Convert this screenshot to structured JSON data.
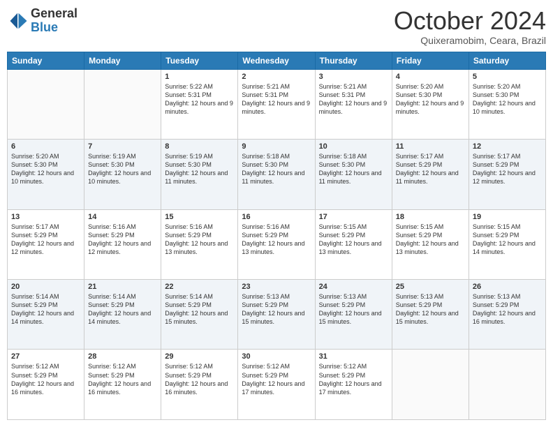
{
  "logo": {
    "general": "General",
    "blue": "Blue"
  },
  "header": {
    "month": "October 2024",
    "location": "Quixeramobim, Ceara, Brazil"
  },
  "weekdays": [
    "Sunday",
    "Monday",
    "Tuesday",
    "Wednesday",
    "Thursday",
    "Friday",
    "Saturday"
  ],
  "weeks": [
    [
      {
        "day": "",
        "info": ""
      },
      {
        "day": "",
        "info": ""
      },
      {
        "day": "1",
        "info": "Sunrise: 5:22 AM\nSunset: 5:31 PM\nDaylight: 12 hours and 9 minutes."
      },
      {
        "day": "2",
        "info": "Sunrise: 5:21 AM\nSunset: 5:31 PM\nDaylight: 12 hours and 9 minutes."
      },
      {
        "day": "3",
        "info": "Sunrise: 5:21 AM\nSunset: 5:31 PM\nDaylight: 12 hours and 9 minutes."
      },
      {
        "day": "4",
        "info": "Sunrise: 5:20 AM\nSunset: 5:30 PM\nDaylight: 12 hours and 9 minutes."
      },
      {
        "day": "5",
        "info": "Sunrise: 5:20 AM\nSunset: 5:30 PM\nDaylight: 12 hours and 10 minutes."
      }
    ],
    [
      {
        "day": "6",
        "info": "Sunrise: 5:20 AM\nSunset: 5:30 PM\nDaylight: 12 hours and 10 minutes."
      },
      {
        "day": "7",
        "info": "Sunrise: 5:19 AM\nSunset: 5:30 PM\nDaylight: 12 hours and 10 minutes."
      },
      {
        "day": "8",
        "info": "Sunrise: 5:19 AM\nSunset: 5:30 PM\nDaylight: 12 hours and 11 minutes."
      },
      {
        "day": "9",
        "info": "Sunrise: 5:18 AM\nSunset: 5:30 PM\nDaylight: 12 hours and 11 minutes."
      },
      {
        "day": "10",
        "info": "Sunrise: 5:18 AM\nSunset: 5:30 PM\nDaylight: 12 hours and 11 minutes."
      },
      {
        "day": "11",
        "info": "Sunrise: 5:17 AM\nSunset: 5:29 PM\nDaylight: 12 hours and 11 minutes."
      },
      {
        "day": "12",
        "info": "Sunrise: 5:17 AM\nSunset: 5:29 PM\nDaylight: 12 hours and 12 minutes."
      }
    ],
    [
      {
        "day": "13",
        "info": "Sunrise: 5:17 AM\nSunset: 5:29 PM\nDaylight: 12 hours and 12 minutes."
      },
      {
        "day": "14",
        "info": "Sunrise: 5:16 AM\nSunset: 5:29 PM\nDaylight: 12 hours and 12 minutes."
      },
      {
        "day": "15",
        "info": "Sunrise: 5:16 AM\nSunset: 5:29 PM\nDaylight: 12 hours and 13 minutes."
      },
      {
        "day": "16",
        "info": "Sunrise: 5:16 AM\nSunset: 5:29 PM\nDaylight: 12 hours and 13 minutes."
      },
      {
        "day": "17",
        "info": "Sunrise: 5:15 AM\nSunset: 5:29 PM\nDaylight: 12 hours and 13 minutes."
      },
      {
        "day": "18",
        "info": "Sunrise: 5:15 AM\nSunset: 5:29 PM\nDaylight: 12 hours and 13 minutes."
      },
      {
        "day": "19",
        "info": "Sunrise: 5:15 AM\nSunset: 5:29 PM\nDaylight: 12 hours and 14 minutes."
      }
    ],
    [
      {
        "day": "20",
        "info": "Sunrise: 5:14 AM\nSunset: 5:29 PM\nDaylight: 12 hours and 14 minutes."
      },
      {
        "day": "21",
        "info": "Sunrise: 5:14 AM\nSunset: 5:29 PM\nDaylight: 12 hours and 14 minutes."
      },
      {
        "day": "22",
        "info": "Sunrise: 5:14 AM\nSunset: 5:29 PM\nDaylight: 12 hours and 15 minutes."
      },
      {
        "day": "23",
        "info": "Sunrise: 5:13 AM\nSunset: 5:29 PM\nDaylight: 12 hours and 15 minutes."
      },
      {
        "day": "24",
        "info": "Sunrise: 5:13 AM\nSunset: 5:29 PM\nDaylight: 12 hours and 15 minutes."
      },
      {
        "day": "25",
        "info": "Sunrise: 5:13 AM\nSunset: 5:29 PM\nDaylight: 12 hours and 15 minutes."
      },
      {
        "day": "26",
        "info": "Sunrise: 5:13 AM\nSunset: 5:29 PM\nDaylight: 12 hours and 16 minutes."
      }
    ],
    [
      {
        "day": "27",
        "info": "Sunrise: 5:12 AM\nSunset: 5:29 PM\nDaylight: 12 hours and 16 minutes."
      },
      {
        "day": "28",
        "info": "Sunrise: 5:12 AM\nSunset: 5:29 PM\nDaylight: 12 hours and 16 minutes."
      },
      {
        "day": "29",
        "info": "Sunrise: 5:12 AM\nSunset: 5:29 PM\nDaylight: 12 hours and 16 minutes."
      },
      {
        "day": "30",
        "info": "Sunrise: 5:12 AM\nSunset: 5:29 PM\nDaylight: 12 hours and 17 minutes."
      },
      {
        "day": "31",
        "info": "Sunrise: 5:12 AM\nSunset: 5:29 PM\nDaylight: 12 hours and 17 minutes."
      },
      {
        "day": "",
        "info": ""
      },
      {
        "day": "",
        "info": ""
      }
    ]
  ]
}
